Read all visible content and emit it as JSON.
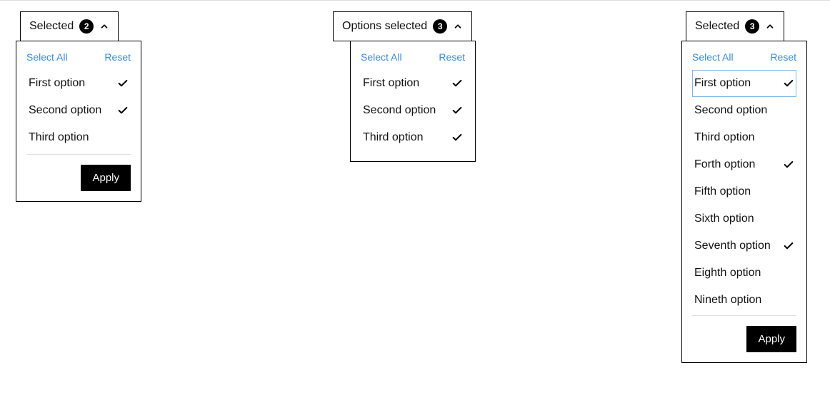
{
  "common": {
    "select_all": "Select All",
    "reset": "Reset",
    "apply": "Apply"
  },
  "dropdowns": [
    {
      "label": "Selected",
      "count": "2",
      "has_apply": true,
      "highlight_index": -1,
      "options": [
        {
          "label": "First option",
          "checked": true
        },
        {
          "label": "Second option",
          "checked": true
        },
        {
          "label": "Third option",
          "checked": false
        }
      ]
    },
    {
      "label": "Options selected",
      "count": "3",
      "has_apply": false,
      "highlight_index": -1,
      "options": [
        {
          "label": "First option",
          "checked": true
        },
        {
          "label": "Second option",
          "checked": true
        },
        {
          "label": "Third option",
          "checked": true
        }
      ]
    },
    {
      "label": "Selected",
      "count": "3",
      "has_apply": true,
      "highlight_index": 0,
      "options": [
        {
          "label": "First option",
          "checked": true
        },
        {
          "label": "Second option",
          "checked": false
        },
        {
          "label": "Third option",
          "checked": false
        },
        {
          "label": "Forth option",
          "checked": true
        },
        {
          "label": "Fifth option",
          "checked": false
        },
        {
          "label": "Sixth option",
          "checked": false
        },
        {
          "label": "Seventh option",
          "checked": true
        },
        {
          "label": "Eighth option",
          "checked": false
        },
        {
          "label": "Nineth option",
          "checked": false
        }
      ]
    }
  ]
}
